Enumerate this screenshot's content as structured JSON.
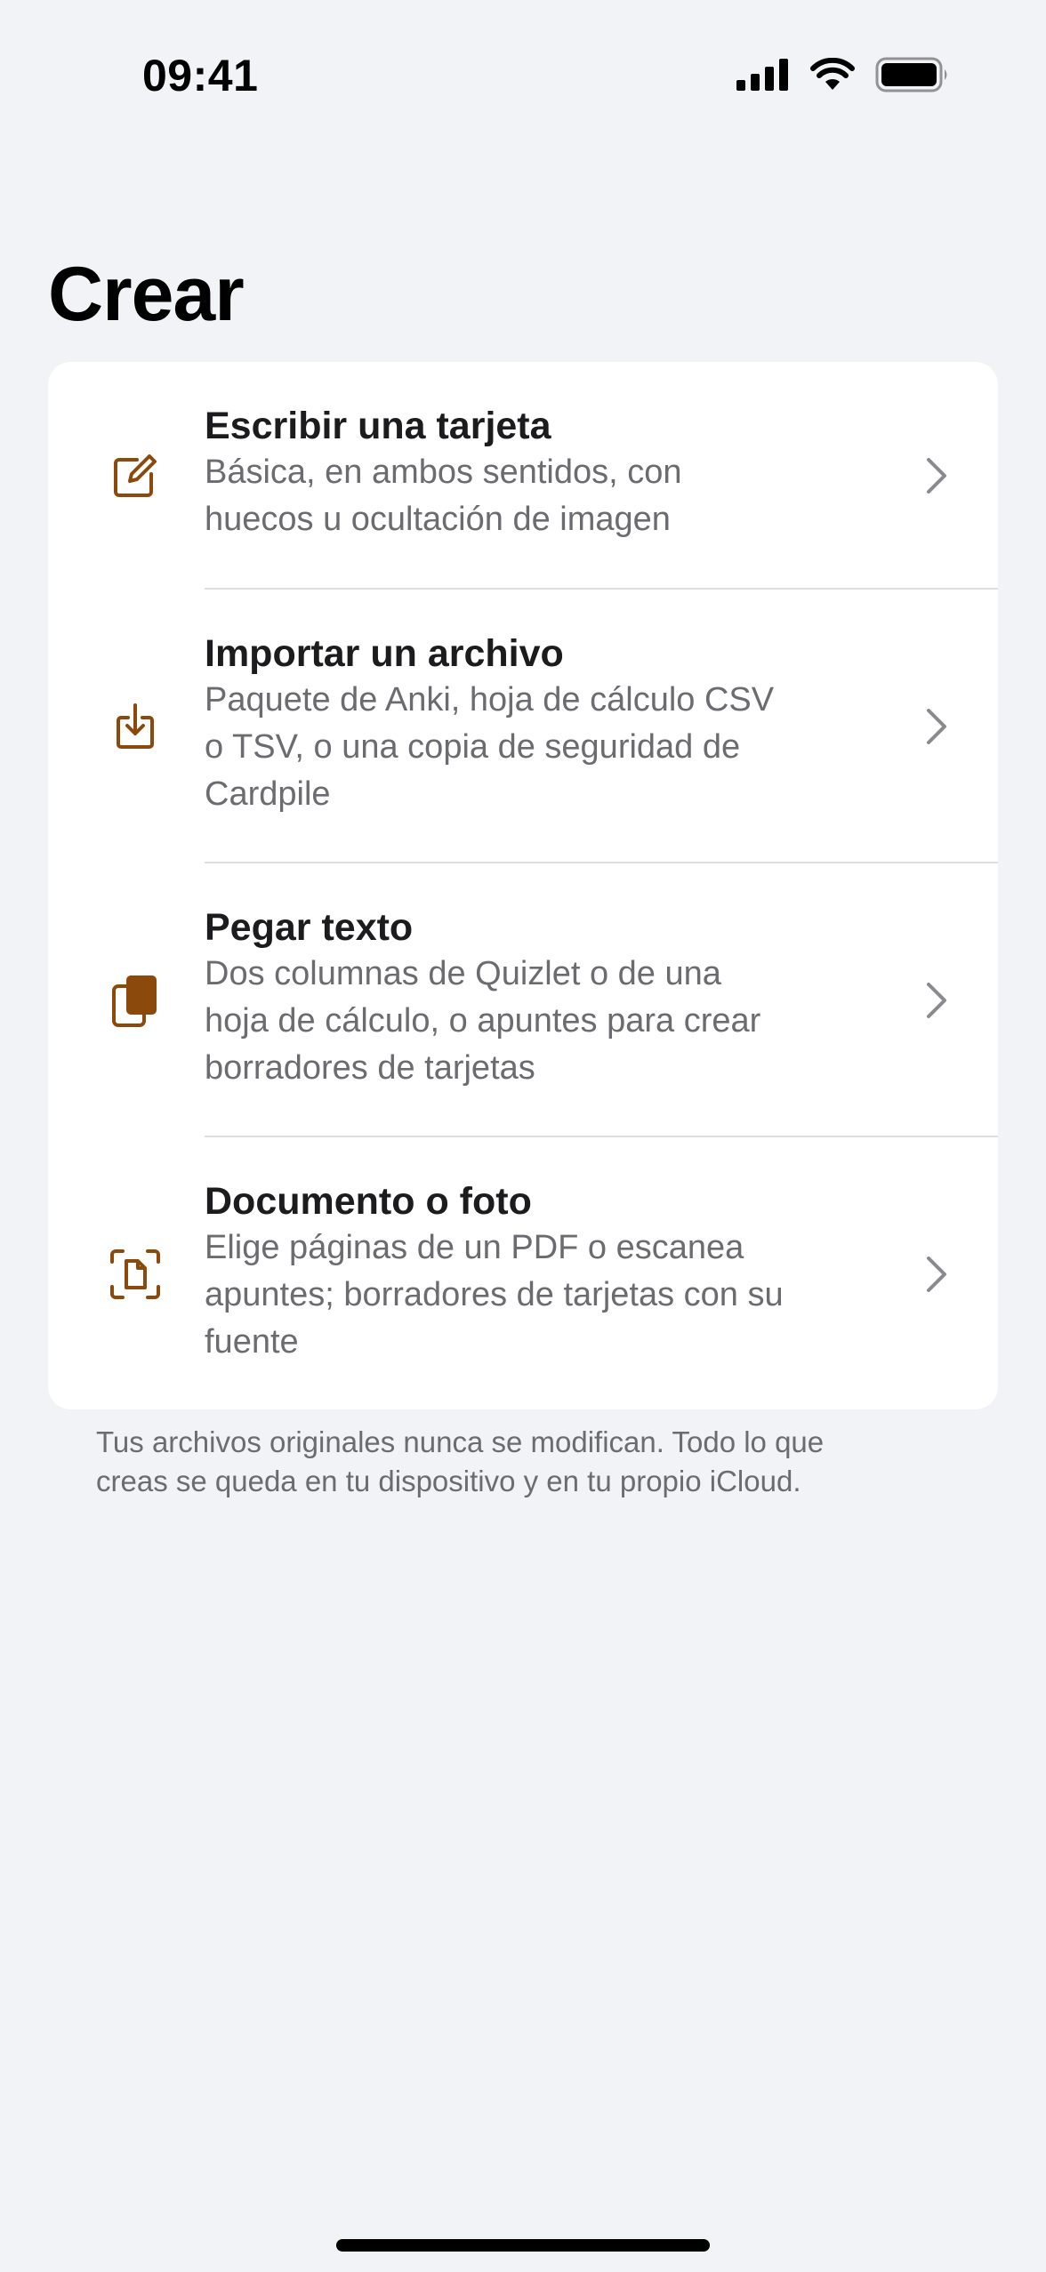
{
  "status_bar": {
    "time": "09:41"
  },
  "header": {
    "title": "Crear"
  },
  "options": [
    {
      "title": "Escribir una tarjeta",
      "subtitle_lines": [
        "Básica, en ambos sentidos, con",
        "huecos u ocultación de imagen"
      ],
      "icon": "compose-icon"
    },
    {
      "title": "Importar un archivo",
      "subtitle_lines": [
        "Paquete de Anki, hoja de cálculo CSV",
        "o TSV, o una copia de seguridad de",
        "Cardpile"
      ],
      "icon": "import-icon"
    },
    {
      "title": "Pegar texto",
      "subtitle_lines": [
        "Dos columnas de Quizlet o de una",
        "hoja de cálculo, o apuntes para crear",
        "borradores de tarjetas"
      ],
      "icon": "clipboard-icon"
    },
    {
      "title": "Documento o foto",
      "subtitle_lines": [
        "Elige páginas de un PDF o escanea",
        "apuntes; borradores de tarjetas con su",
        "fuente"
      ],
      "icon": "document-scan-icon"
    }
  ],
  "footer": {
    "lines": [
      "Tus archivos originales nunca se modifican. Todo lo que",
      "creas se queda en tu dispositivo y en tu propio iCloud."
    ]
  },
  "colors": {
    "accent": "#8b4a0c",
    "background": "#f2f3f6",
    "card": "#ffffff"
  }
}
